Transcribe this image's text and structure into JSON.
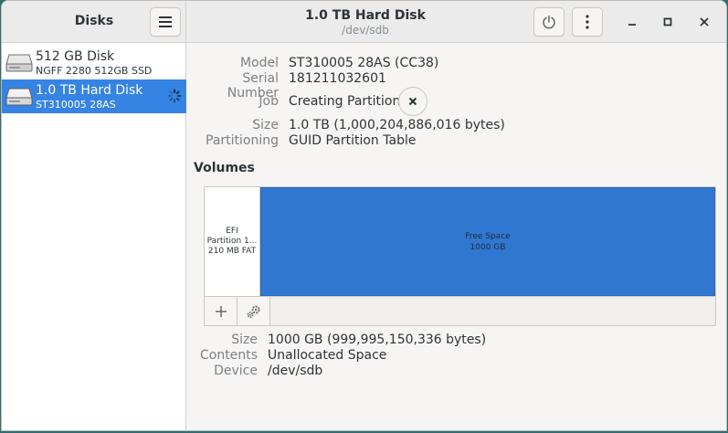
{
  "app": {
    "title": "Disks"
  },
  "header": {
    "disk_title": "1.0 TB Hard Disk",
    "disk_device": "/dev/sdb"
  },
  "sidebar": {
    "items": [
      {
        "name": "512 GB Disk",
        "sub": "NGFF 2280 512GB SSD",
        "icon": "drive-icon",
        "selected": false
      },
      {
        "name": "1.0 TB Hard Disk",
        "sub": "ST310005 28AS",
        "icon": "drive-icon",
        "selected": true,
        "busy": true
      }
    ]
  },
  "disk_props": {
    "model_label": "Model",
    "model_value": "ST310005 28AS (CC38)",
    "serial_label": "Serial Number",
    "serial_value": "181211032601",
    "job_label": "Job",
    "job_value": "Creating Partition",
    "size_label": "Size",
    "size_value": "1.0 TB (1,000,204,886,016 bytes)",
    "partitioning_label": "Partitioning",
    "partitioning_value": "GUID Partition Table"
  },
  "volumes": {
    "heading": "Volumes",
    "partitions": [
      {
        "line1": "EFI",
        "line2": "Partition 1...",
        "line3": "210 MB FAT"
      },
      {
        "line1": "Free Space",
        "line2": "1000 GB"
      }
    ]
  },
  "volume_props": {
    "size_label": "Size",
    "size_value": "1000 GB (999,995,150,336 bytes)",
    "contents_label": "Contents",
    "contents_value": "Unallocated Space",
    "device_label": "Device",
    "device_value": "/dev/sdb"
  },
  "colors": {
    "accent": "#3584e4",
    "free_space": "#3077d1"
  }
}
